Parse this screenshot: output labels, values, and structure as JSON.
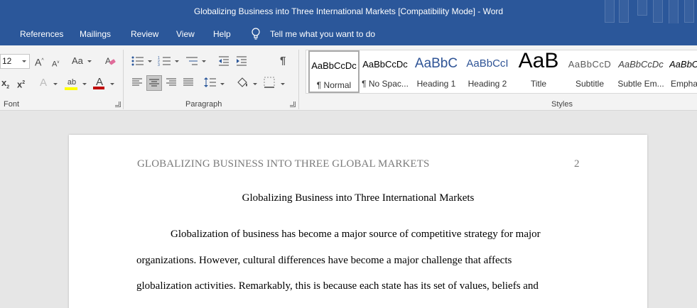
{
  "window": {
    "title": "Globalizing Business into Three International Markets [Compatibility Mode]  -  Word"
  },
  "tabs": [
    "References",
    "Mailings",
    "Review",
    "View",
    "Help"
  ],
  "tell_me": "Tell me what you want to do",
  "font_group": {
    "size": "12",
    "label": "Font",
    "grow_icon": "A",
    "shrink_icon": "A",
    "case_icon": "Aa",
    "subscript": "x",
    "superscript": "x",
    "effects_icon": "A",
    "highlight_icon": "ab",
    "font_color_icon": "A",
    "highlight_color": "#ffff00",
    "font_color": "#c00000"
  },
  "paragraph_group": {
    "label": "Paragraph",
    "pilcrow": "¶"
  },
  "styles_group": {
    "label": "Styles",
    "items": [
      {
        "preview": "AaBbCcDc",
        "name": "¶ Normal",
        "selected": true
      },
      {
        "preview": "AaBbCcDc",
        "name": "¶ No Spac..."
      },
      {
        "preview": "AaBbC",
        "name": "Heading 1",
        "color": "#2f5496"
      },
      {
        "preview": "AaBbCcI",
        "name": "Heading 2",
        "color": "#2f5496"
      },
      {
        "preview": "AaB",
        "name": "Title"
      },
      {
        "preview": "AaBbCcD",
        "name": "Subtitle",
        "color": "#5a5a5a"
      },
      {
        "preview": "AaBbCcDc",
        "name": "Subtle Em...",
        "color": "#404040"
      },
      {
        "preview": "AaBbC",
        "name": "Empha..."
      }
    ]
  },
  "document": {
    "running_head": "GLOBALIZING BUSINESS INTO THREE GLOBAL MARKETS",
    "page_number": "2",
    "title": "Globalizing Business into Three International Markets",
    "lines": [
      "Globalization of business has become a major source of competitive strategy for major",
      "organizations. However, cultural differences have become a major challenge that affects",
      "globalization activities. Remarkably, this is because each state has its set of values, beliefs and"
    ]
  }
}
